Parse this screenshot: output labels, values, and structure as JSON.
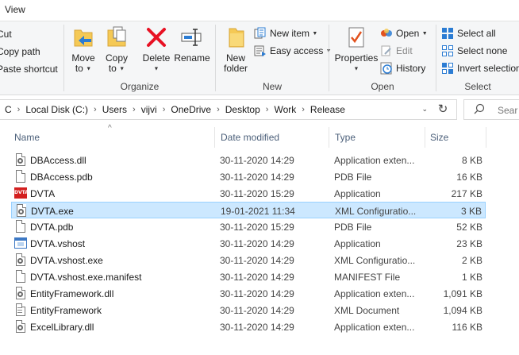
{
  "tabs": {
    "view": "View"
  },
  "clipboard": {
    "cut": "Cut",
    "copy_path": "Copy path",
    "paste_shortcut": "Paste shortcut"
  },
  "organize": {
    "label": "Organize",
    "move_to": [
      "Move",
      "to"
    ],
    "copy_to": [
      "Copy",
      "to"
    ],
    "delete": "Delete",
    "rename": "Rename"
  },
  "new": {
    "label": "New",
    "new_folder": [
      "New",
      "folder"
    ],
    "new_item": "New item",
    "easy_access": "Easy access"
  },
  "open": {
    "label": "Open",
    "properties": "Properties",
    "open": "Open",
    "edit": "Edit",
    "history": "History"
  },
  "select": {
    "label": "Select",
    "select_all": "Select all",
    "select_none": "Select none",
    "invert_selection": "Invert selection"
  },
  "address": {
    "crumbs": [
      "C",
      "Local Disk (C:)",
      "Users",
      "vijvi",
      "OneDrive",
      "Desktop",
      "Work",
      "Release"
    ]
  },
  "search": {
    "placeholder": "Sear"
  },
  "columns": {
    "name": "Name",
    "date": "Date modified",
    "type": "Type",
    "size": "Size"
  },
  "files": [
    {
      "name": "DBAccess.dll",
      "date": "30-11-2020 14:29",
      "type": "Application exten...",
      "size": "8 KB",
      "icon": "gear-file-icon"
    },
    {
      "name": "DBAccess.pdb",
      "date": "30-11-2020 14:29",
      "type": "PDB File",
      "size": "16 KB",
      "icon": "file-icon"
    },
    {
      "name": "DVTA",
      "date": "30-11-2020 15:29",
      "type": "Application",
      "size": "217 KB",
      "icon": "dvta-app-icon"
    },
    {
      "name": "DVTA.exe",
      "date": "19-01-2021 11:34",
      "type": "XML Configuratio...",
      "size": "3 KB",
      "icon": "config-file-icon",
      "selected": true
    },
    {
      "name": "DVTA.pdb",
      "date": "30-11-2020 15:29",
      "type": "PDB File",
      "size": "52 KB",
      "icon": "file-icon"
    },
    {
      "name": "DVTA.vshost",
      "date": "30-11-2020 14:29",
      "type": "Application",
      "size": "23 KB",
      "icon": "app-icon"
    },
    {
      "name": "DVTA.vshost.exe",
      "date": "30-11-2020 14:29",
      "type": "XML Configuratio...",
      "size": "2 KB",
      "icon": "config-file-icon"
    },
    {
      "name": "DVTA.vshost.exe.manifest",
      "date": "30-11-2020 14:29",
      "type": "MANIFEST File",
      "size": "1 KB",
      "icon": "file-icon"
    },
    {
      "name": "EntityFramework.dll",
      "date": "30-11-2020 14:29",
      "type": "Application exten...",
      "size": "1,091 KB",
      "icon": "gear-file-icon"
    },
    {
      "name": "EntityFramework",
      "date": "30-11-2020 14:29",
      "type": "XML Document",
      "size": "1,094 KB",
      "icon": "xml-file-icon"
    },
    {
      "name": "ExcelLibrary.dll",
      "date": "30-11-2020 14:29",
      "type": "Application exten...",
      "size": "116 KB",
      "icon": "gear-file-icon"
    }
  ],
  "colors": {
    "selection_bg": "#cce8ff",
    "selection_border": "#99d1ff",
    "header_text": "#4c607a",
    "delete_red": "#e81123"
  }
}
